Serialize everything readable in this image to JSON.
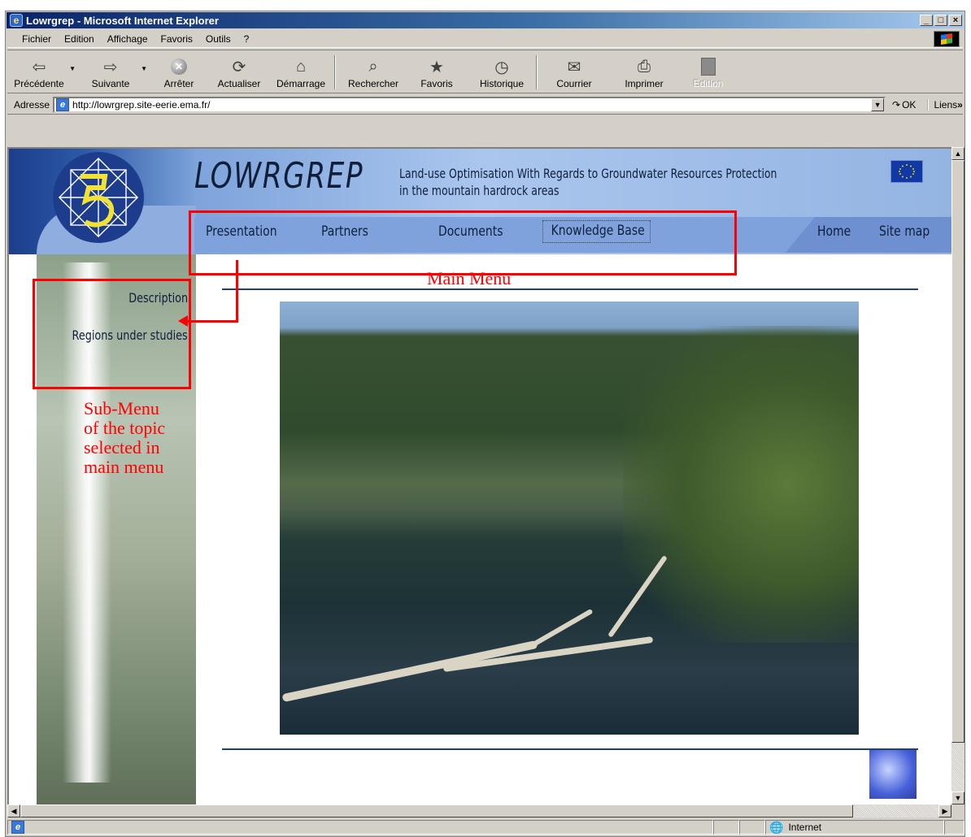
{
  "window": {
    "title": "Lowrgrep - Microsoft Internet Explorer",
    "min_label": "_",
    "max_label": "□",
    "close_label": "×"
  },
  "menubar": {
    "items": [
      "Fichier",
      "Edition",
      "Affichage",
      "Favoris",
      "Outils",
      "?"
    ]
  },
  "toolbar": {
    "back": "Précédente",
    "forward": "Suivante",
    "stop": "Arrêter",
    "refresh": "Actualiser",
    "home": "Démarrage",
    "search": "Rechercher",
    "favorites": "Favoris",
    "history": "Historique",
    "mail": "Courrier",
    "print": "Imprimer",
    "edit": "Edition"
  },
  "address": {
    "label": "Adresse",
    "url": "http://lowrgrep.site-eerie.ema.fr/",
    "go_label": "OK",
    "links_label": "Liens"
  },
  "page": {
    "site_title": "LOWRGREP",
    "tagline_line1": "Land-use Optimisation With Regards to Groundwater Resources Protection",
    "tagline_line2": "in the mountain hardrock areas",
    "main_menu": [
      "Presentation",
      "Partners",
      "Documents",
      "Knowledge Base"
    ],
    "right_menu": [
      "Home",
      "Site map"
    ],
    "sub_menu": [
      "Description",
      "Regions under studies"
    ]
  },
  "annotations": {
    "main_menu": "Main Menu",
    "sub_menu_lines": [
      "Sub-Menu",
      "of the topic",
      "selected in",
      "main menu"
    ]
  },
  "statusbar": {
    "zone": "Internet"
  },
  "colors": {
    "annotation": "#ff0000",
    "banner_dark": "#1c3d8c",
    "menu_bar": "#7fa2dc"
  }
}
